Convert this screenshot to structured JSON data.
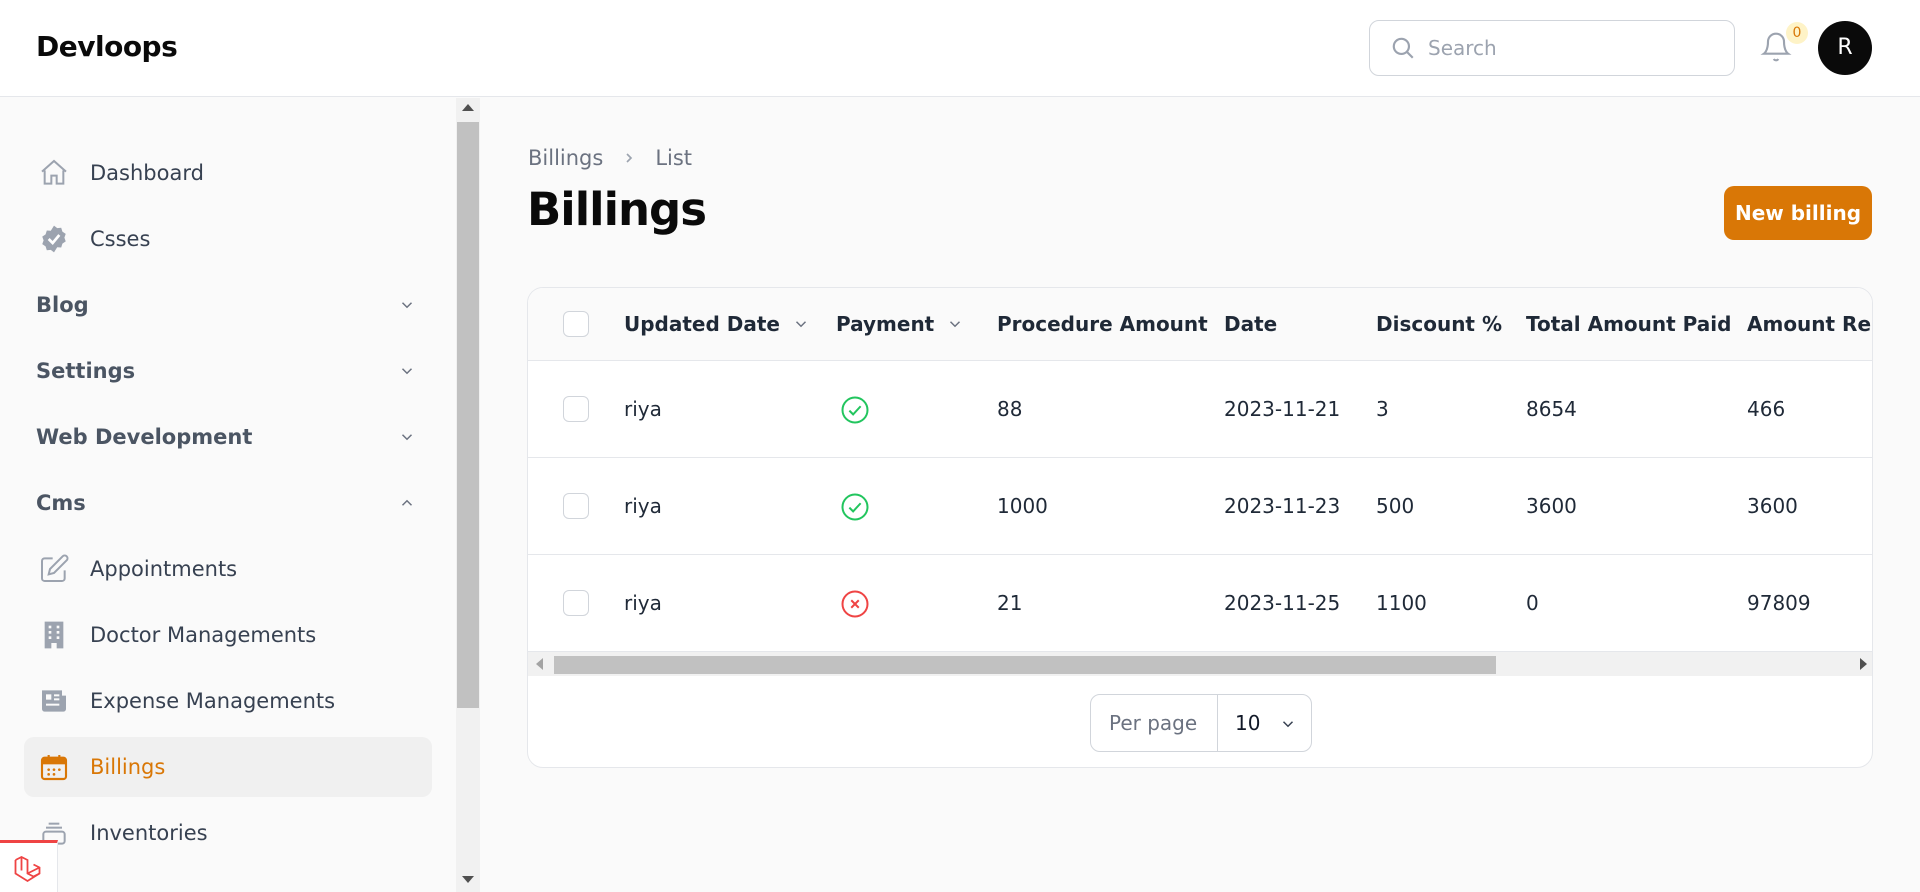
{
  "app": {
    "brand": "Devloops"
  },
  "header": {
    "search_placeholder": "Search",
    "notification_count": "0",
    "avatar_initial": "R"
  },
  "sidebar": {
    "items": [
      {
        "label": "Dashboard",
        "icon": "home-icon"
      },
      {
        "label": "Csses",
        "icon": "badge-check-icon"
      }
    ],
    "groups": [
      {
        "label": "Blog",
        "state": "collapsed"
      },
      {
        "label": "Settings",
        "state": "collapsed"
      },
      {
        "label": "Web Development",
        "state": "collapsed"
      },
      {
        "label": "Cms",
        "state": "expanded"
      }
    ],
    "cms_items": [
      {
        "label": "Appointments",
        "icon": "pencil-square-icon"
      },
      {
        "label": "Doctor Managements",
        "icon": "building-icon"
      },
      {
        "label": "Expense Managements",
        "icon": "newspaper-icon"
      },
      {
        "label": "Billings",
        "icon": "calendar-icon",
        "active": true
      },
      {
        "label": "Inventories",
        "icon": "stack-icon"
      }
    ]
  },
  "main": {
    "breadcrumb": [
      "Billings",
      "List"
    ],
    "title": "Billings",
    "new_button": "New billing",
    "table": {
      "columns": [
        "Updated Date",
        "Payment",
        "Procedure Amount",
        "Date",
        "Discount %",
        "Total Amount Paid",
        "Amount Rem"
      ],
      "rows": [
        {
          "updated": "riya",
          "payment": "paid",
          "procedure": "88",
          "date": "2023-11-21",
          "discount": "3",
          "total_paid": "8654",
          "remaining": "466"
        },
        {
          "updated": "riya",
          "payment": "paid",
          "procedure": "1000",
          "date": "2023-11-23",
          "discount": "500",
          "total_paid": "3600",
          "remaining": "3600"
        },
        {
          "updated": "riya",
          "payment": "unpaid",
          "procedure": "21",
          "date": "2023-11-25",
          "discount": "1100",
          "total_paid": "0",
          "remaining": "97809"
        }
      ]
    },
    "pagination": {
      "per_page_label": "Per page",
      "per_page_value": "10"
    }
  },
  "colors": {
    "accent": "#d97706",
    "success": "#22c55e",
    "danger": "#ef4444"
  }
}
